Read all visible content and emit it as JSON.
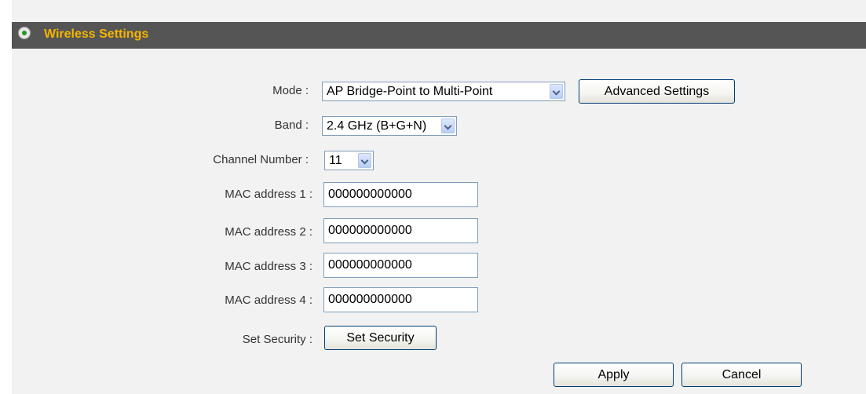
{
  "header": {
    "title": "Wireless Settings",
    "icon": "radio-bullet-icon"
  },
  "form": {
    "mode": {
      "label": "Mode :",
      "value": "AP Bridge-Point to Multi-Point"
    },
    "advanced_button": "Advanced Settings",
    "band": {
      "label": "Band :",
      "value": "2.4 GHz (B+G+N)"
    },
    "channel": {
      "label": "Channel Number :",
      "value": "11"
    },
    "mac1": {
      "label": "MAC address 1 :",
      "value": "000000000000"
    },
    "mac2": {
      "label": "MAC address 2 :",
      "value": "000000000000"
    },
    "mac3": {
      "label": "MAC address 3 :",
      "value": "000000000000"
    },
    "mac4": {
      "label": "MAC address 4 :",
      "value": "000000000000"
    },
    "security": {
      "label": "Set Security :",
      "button": "Set Security"
    }
  },
  "actions": {
    "apply": "Apply",
    "cancel": "Cancel"
  },
  "colors": {
    "header_bg": "#555555",
    "header_title": "#f5b400",
    "panel_bg": "#f2f2f2"
  }
}
